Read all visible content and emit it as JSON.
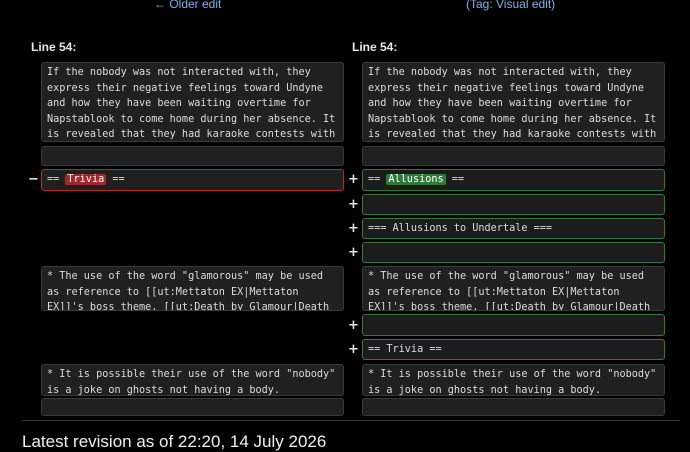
{
  "nav": {
    "older_edit": "← Older edit",
    "tag": "(Tag: Visual edit)"
  },
  "left": {
    "line_label": "Line 54:",
    "para1": "If the nobody was not interacted with, they express their negative feelings toward Undyne and how they have been waiting overtime for Napstablook to come home during her absence. It is revealed that they had karaoke contests with Undyne, with the latter making it “''impossible to lose''”.",
    "trivia_prefix": "== ",
    "trivia_word": "Trivia",
    "trivia_suffix": " ==",
    "glamorous": "* The use of the word \"glamorous\" may be used as reference to [[ut:Mettaton EX|Mettaton EX]]'s boss theme, [[ut:Death by Glamour|Death By Glamour]].",
    "nobody": "* It is possible their use of the word \"nobody\" is a joke on ghosts not having a body."
  },
  "right": {
    "line_label": "Line 54:",
    "para1": "If the nobody was not interacted with, they express their negative feelings toward Undyne and how they have been waiting overtime for Napstablook to come home during her absence. It is revealed that they had karaoke contests with Undyne, with the latter making it “''impossible to lose''”.",
    "allusions_prefix": "== ",
    "allusions_word": "Allusions",
    "allusions_suffix": " ==",
    "allusions_undertale": "=== Allusions to Undertale ===",
    "glamorous": "* The use of the word \"glamorous\" may be used as reference to [[ut:Mettaton EX|Mettaton EX]]'s boss theme, [[ut:Death by Glamour|Death By Glamour]].",
    "trivia": "== Trivia ==",
    "nobody": "* It is possible their use of the word \"nobody\" is a joke on ghosts not having a body."
  },
  "markers": {
    "minus": "−",
    "plus": "+"
  },
  "footer": {
    "text": "Latest revision as of 22:20, 14 July 2026"
  },
  "colors": {
    "removed": "#a3262c",
    "added": "#2f7a3a",
    "link": "#7fb2e6"
  }
}
